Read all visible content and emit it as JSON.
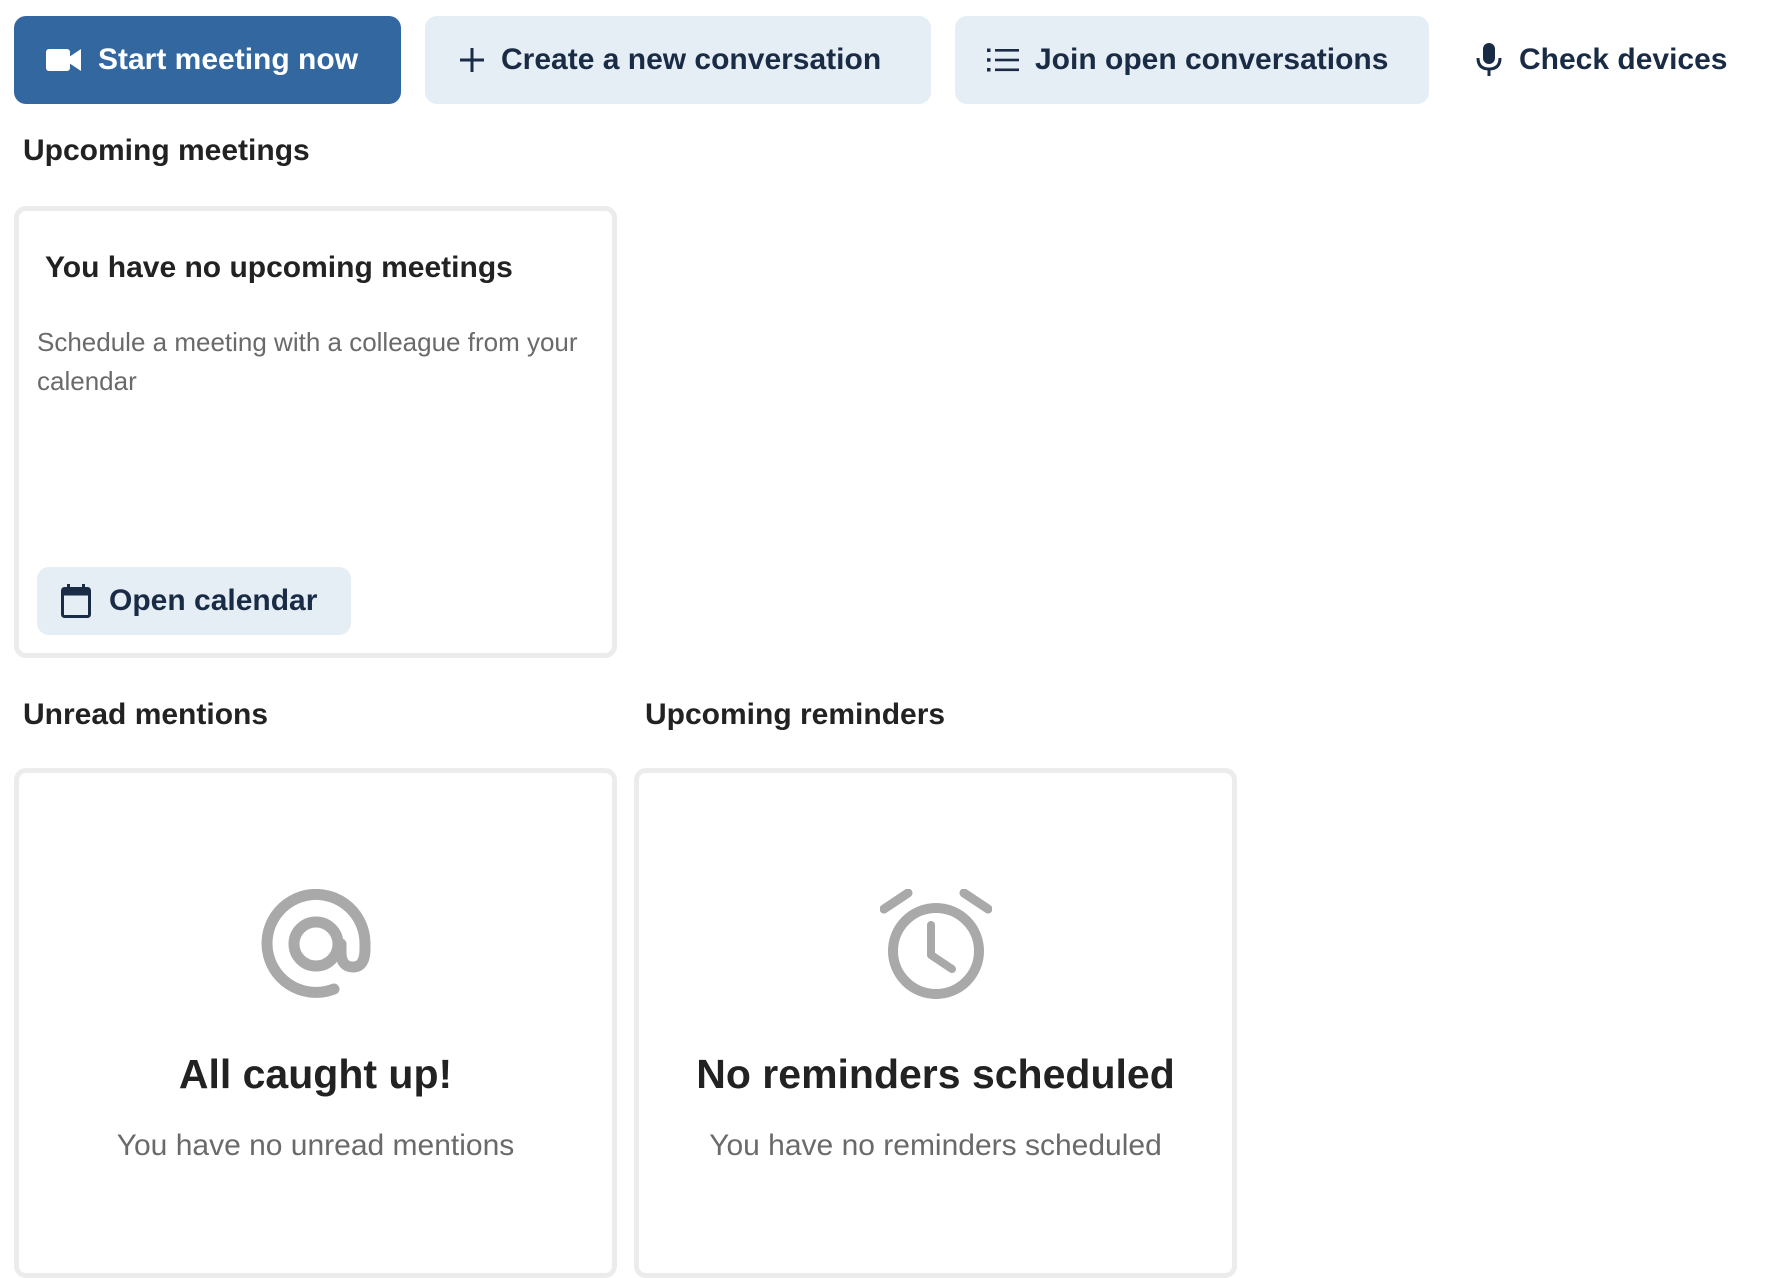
{
  "colors": {
    "primary": "#33679f",
    "secondary_bg": "#e5edf5",
    "secondary_text": "#1a2c45",
    "muted_text": "#6a6a6a",
    "card_border": "#ececec",
    "empty_icon": "#a9a9a9"
  },
  "toolbar": {
    "start_meeting": {
      "label": "Start meeting now",
      "icon": "video-camera-icon"
    },
    "create_conversation": {
      "label": "Create a new conversation",
      "icon": "plus-icon"
    },
    "join_conversations": {
      "label": "Join open conversations",
      "icon": "list-icon"
    },
    "check_devices": {
      "label": "Check devices",
      "icon": "microphone-icon"
    }
  },
  "upcoming_meetings": {
    "heading": "Upcoming meetings",
    "card_title": "You have no upcoming meetings",
    "card_description": "Schedule a meeting with a colleague from your calendar",
    "open_calendar": {
      "label": "Open calendar",
      "icon": "calendar-icon"
    }
  },
  "unread_mentions": {
    "heading": "Unread mentions",
    "icon": "at-sign-icon",
    "title": "All caught up!",
    "subtitle": "You have no unread mentions"
  },
  "upcoming_reminders": {
    "heading": "Upcoming reminders",
    "icon": "alarm-clock-icon",
    "title": "No reminders scheduled",
    "subtitle": "You have no reminders scheduled"
  }
}
